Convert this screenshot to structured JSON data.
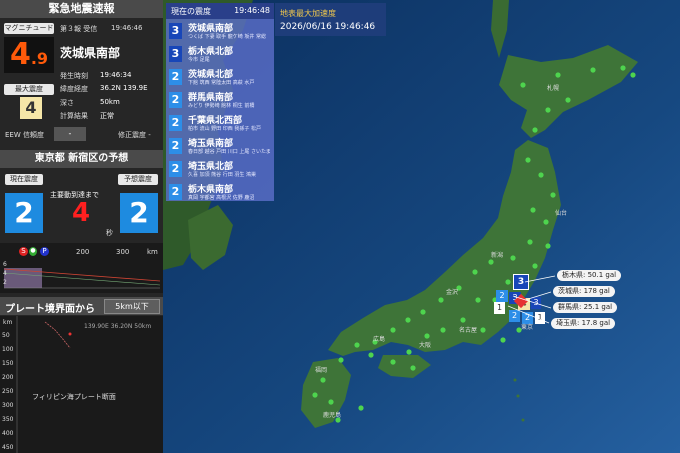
{
  "left": {
    "title": "緊急地震速報",
    "mag_label": "マグニチュード",
    "report": "第３報 受信",
    "report_time": "19:46:46",
    "magnitude_int": "4",
    "magnitude_dec": ".9",
    "region": "茨城県南部",
    "origin_label": "発生時刻",
    "origin_time": "19:46:34",
    "latlon_label": "緯度経度",
    "latlon": "36.2N 139.9E",
    "maxint_label": "最大震度",
    "maxint": "4",
    "depth_label": "深さ",
    "depth": "50km",
    "calc_label": "計算結果",
    "calc": "正常",
    "eew_label": "EEW 信頼度",
    "eew_value": "-",
    "corr_label": "修正震度 -",
    "forecast_title": "東京都 新宿区の予想",
    "current_label": "現在震度",
    "current_int": "2",
    "arrival_label": "主要動到達まで",
    "arrival_sec": "4",
    "sec_unit": "秒",
    "forecast_label": "予想震度",
    "forecast_int": "2",
    "s_marker": "S",
    "p_marker": "P",
    "dist_ticks": [
      "200",
      "300",
      "km"
    ],
    "y_ticks": [
      "6",
      "4",
      "2"
    ],
    "plate_title": "プレート境界面から",
    "plate_button": "5km以下",
    "section_km": "km",
    "section_info": "139.90E 36.20N 50km",
    "section_depths": [
      "50",
      "100",
      "150",
      "200",
      "250",
      "300",
      "350",
      "400",
      "450"
    ],
    "plate_name": "フィリピン海プレート断面"
  },
  "list": {
    "title": "現在の震度",
    "time": "19:46:48",
    "rows": [
      {
        "int": "3",
        "name": "茨城県南部",
        "cities": "つくば 下妻 取手 龍ケ崎 坂井 常総"
      },
      {
        "int": "3",
        "name": "栃木県北部",
        "cities": "今市 足尾"
      },
      {
        "int": "2",
        "name": "茨城県北部",
        "cities": "下館 筑西 常陸太田 高萩 水戸"
      },
      {
        "int": "2",
        "name": "群馬県南部",
        "cities": "みどり 伊勢崎 館林 桐生 前橋"
      },
      {
        "int": "2",
        "name": "千葉県北西部",
        "cities": "柏市 流山 野田 印西 我孫子 松戸"
      },
      {
        "int": "2",
        "name": "埼玉県南部",
        "cities": "春日部 越谷 戸田 川口 上尾 さいたま"
      },
      {
        "int": "2",
        "name": "埼玉県北部",
        "cities": "久喜 加須 熊谷 行田 羽生 鴻巣"
      },
      {
        "int": "2",
        "name": "栃木県南部",
        "cities": "真岡 宇都宮 高根沢 佐野 鹿沼"
      }
    ]
  },
  "pga": {
    "title": "地表最大加速度",
    "datetime": "2026/06/16 19:46:46"
  },
  "gal_labels": [
    {
      "name": "栃木県",
      "value": "50.1 gal"
    },
    {
      "name": "茨城県",
      "value": "178 gal"
    },
    {
      "name": "群馬県",
      "value": "25.1 gal"
    },
    {
      "name": "埼玉県",
      "value": "17.8 gal"
    }
  ],
  "map_labels": {
    "sapporo": "札幌",
    "sendai": "仙台",
    "tokyo": "東京",
    "osaka": "大阪",
    "niigata": "新潟",
    "kanazawa": "金沢",
    "nagoya": "名古屋",
    "hiroshima": "広島",
    "fukuoka": "福岡",
    "kagoshima": "鹿児島"
  },
  "colors": {
    "int2": "#2d8ee8",
    "int3": "#1846b8",
    "int4": "#f5e6a8",
    "mag": "#ff5a0a"
  }
}
